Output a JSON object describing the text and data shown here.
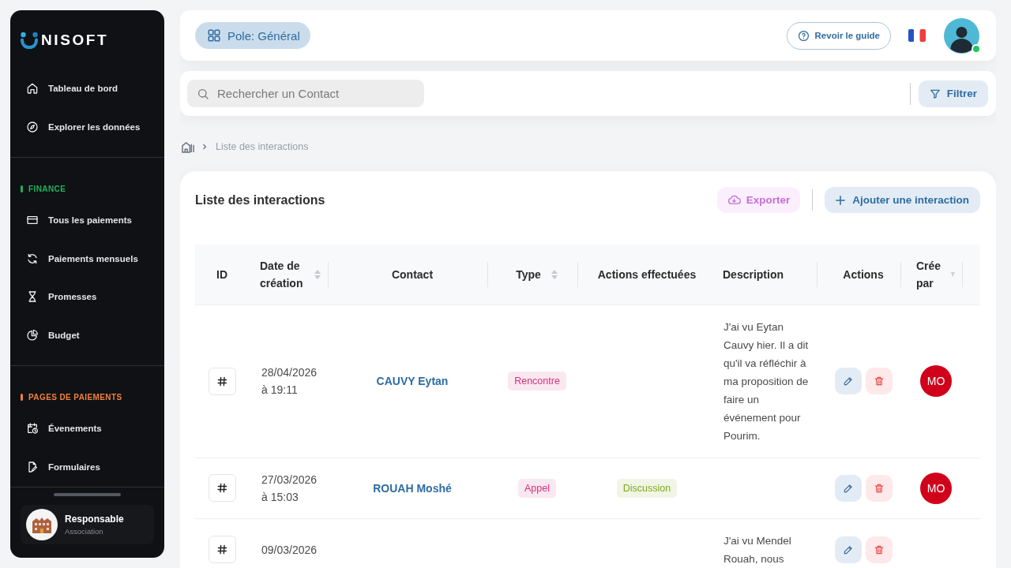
{
  "sidebar": {
    "logo_text": "NISOFT",
    "sections": [
      {
        "items": [
          {
            "label": "Tableau de bord",
            "selected": false
          },
          {
            "label": "Explorer les données",
            "selected": false
          }
        ]
      },
      {
        "title": "FINANCE",
        "color": "#1fb35a",
        "items": [
          {
            "label": "Tous les paiements",
            "selected": false
          },
          {
            "label": "Paiements mensuels",
            "selected": false
          },
          {
            "label": "Promesses",
            "selected": false
          },
          {
            "label": "Budget",
            "selected": false
          }
        ]
      },
      {
        "title": "PAGES DE PAIEMENTS",
        "color": "#f0803c",
        "items": [
          {
            "label": "Évenements",
            "selected": false
          },
          {
            "label": "Formulaires",
            "selected": false
          }
        ]
      }
    ],
    "user": {
      "name": "Responsable",
      "role": "Association"
    }
  },
  "topbar": {
    "pole": "Pole: Général",
    "guide_button": "Revoir le guide",
    "avatar": {
      "online": true
    }
  },
  "search": {
    "placeholder": "Rechercher un Contact",
    "filter_button": "Filtrer"
  },
  "breadcrumb": {
    "current": "Liste des interactions"
  },
  "interactions": {
    "title": "Liste des interactions",
    "export_button": "Exporter",
    "add_button": "Ajouter une interaction",
    "columns": [
      {
        "label": "ID",
        "kind": "plain"
      },
      {
        "label": "Date de création",
        "kind": "sort"
      },
      {
        "label": "Contact",
        "kind": "plain"
      },
      {
        "label": "Type",
        "kind": "sort"
      },
      {
        "label": "Actions effectuées",
        "kind": "plain"
      },
      {
        "label": "Description",
        "kind": "plain"
      },
      {
        "label": "Actions",
        "kind": "plain"
      },
      {
        "label": "Crée par",
        "kind": "filter"
      }
    ],
    "rows": [
      {
        "date": "28/04/2026",
        "time": "à 19:11",
        "contact": "CAUVY Eytan",
        "type": {
          "label": "Rencontre",
          "color": "#d6317a"
        },
        "description": "J'ai vu Eytan Cauvy hier. Il a dit qu'il va réfléchir à ma proposition de faire un événement pour Pourim.",
        "created_by": "MO"
      },
      {
        "date": "27/03/2026",
        "time": "à 15:03",
        "contact": "ROUAH Moshé",
        "type": {
          "label": "Appel",
          "color": "#d6317a"
        },
        "actions_done": [
          {
            "label": "Discussion",
            "color": "#7fa81a"
          }
        ],
        "created_by": "MO"
      },
      {
        "date": "09/03/2026",
        "description": "J'ai vu Mendel Rouah, nous"
      }
    ]
  }
}
